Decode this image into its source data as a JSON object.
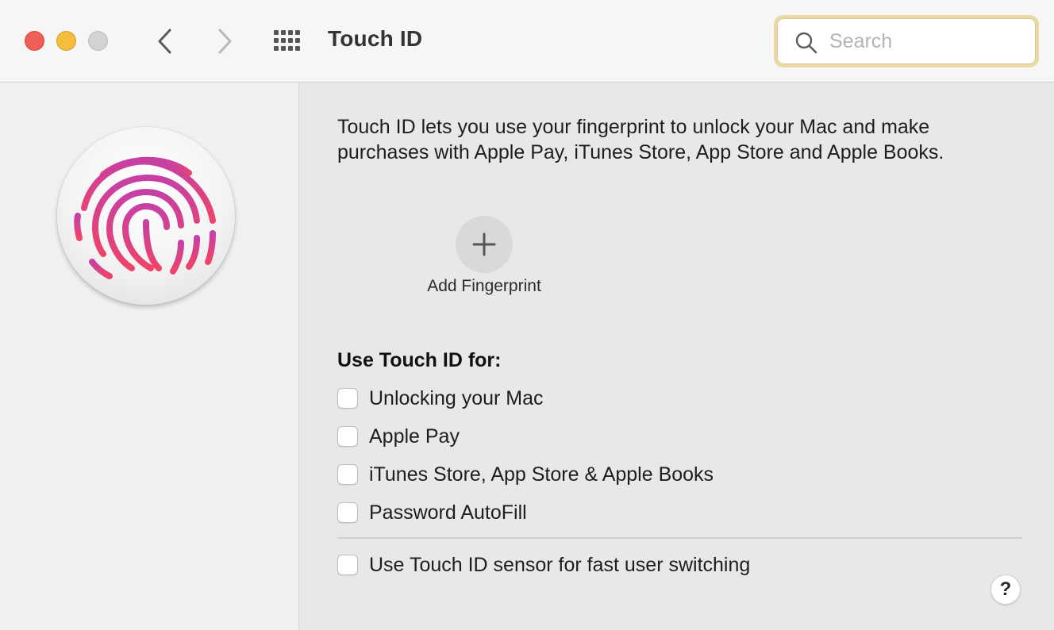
{
  "window": {
    "title": "Touch ID",
    "search_placeholder": "Search"
  },
  "toolbar": {
    "icons": [
      "close-icon",
      "minimize-icon",
      "zoom-icon",
      "chevron-left-icon",
      "chevron-right-icon",
      "grid-icon",
      "search-icon"
    ]
  },
  "main": {
    "description": "Touch ID lets you use your fingerprint to unlock your Mac and make purchases with Apple Pay, iTunes Store, App Store and Apple Books.",
    "add_fingerprint": {
      "symbol": "+",
      "label": "Add Fingerprint"
    },
    "section_title": "Use Touch ID for:",
    "options": [
      {
        "label": "Unlocking your Mac",
        "checked": false
      },
      {
        "label": "Apple Pay",
        "checked": false
      },
      {
        "label": "iTunes Store, App Store & Apple Books",
        "checked": false
      },
      {
        "label": "Password AutoFill",
        "checked": false
      }
    ],
    "extra_option": {
      "label": "Use Touch ID sensor for fast user switching",
      "checked": false
    },
    "help_label": "?"
  },
  "colors": {
    "close": "#ee5f57",
    "minimize": "#f4bd3d",
    "zoom": "#d3d3d3",
    "fingerprint": "#e2407f",
    "search_focus": "#ecd8a3"
  }
}
